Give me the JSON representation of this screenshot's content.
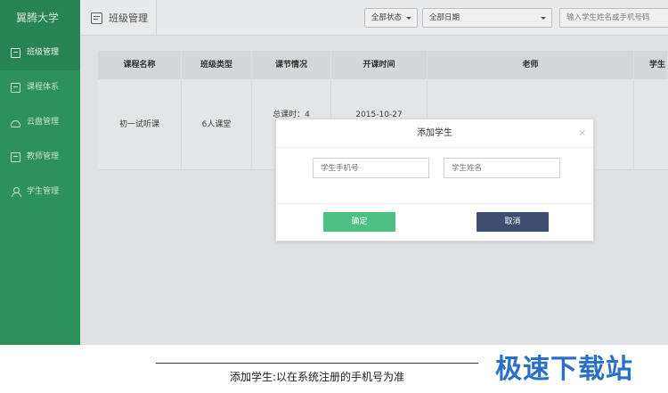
{
  "sidebar": {
    "brand": "翼腾大学",
    "items": [
      {
        "label": "班级管理",
        "icon": "calendar-icon"
      },
      {
        "label": "课程体系",
        "icon": "book-icon"
      },
      {
        "label": "云盘管理",
        "icon": "cloud-icon"
      },
      {
        "label": "教师管理",
        "icon": "teacher-icon"
      },
      {
        "label": "学生管理",
        "icon": "student-icon"
      }
    ]
  },
  "header": {
    "title": "班级管理",
    "status_filter": "全部状态",
    "date_filter": "全部日期",
    "search_placeholder": "输入学生姓名或手机号码"
  },
  "table": {
    "columns": [
      "课程名称",
      "班级类型",
      "课节情况",
      "开课时间",
      "老师",
      "学生"
    ],
    "rows": [
      {
        "course": "初一试听课",
        "class_type": "6人课堂",
        "lessons": "总课时：4",
        "start": "2015-10-27",
        "teacher": "",
        "student": ""
      }
    ]
  },
  "modal": {
    "title": "添加学生",
    "close": "×",
    "phone_placeholder": "学生手机号",
    "name_placeholder": "学生姓名",
    "confirm_label": "确定",
    "cancel_label": "取消"
  },
  "caption": "添加学生:以在系统注册的手机号为准",
  "watermark": "极速下载站",
  "colors": {
    "sidebar": "#2f9b63",
    "confirm": "#4cbf82",
    "cancel": "#3f4d6e",
    "watermark": "#2b6fc6"
  }
}
